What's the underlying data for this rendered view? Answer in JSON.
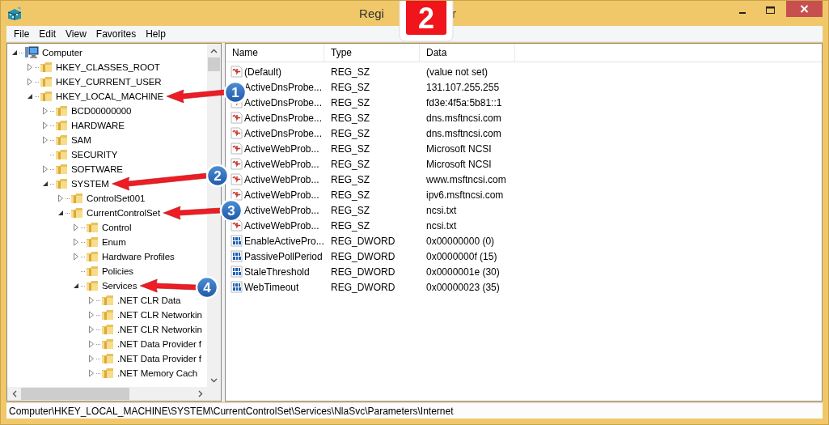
{
  "window": {
    "title_start": "Regi",
    "title_end": "r"
  },
  "menu": [
    "File",
    "Edit",
    "View",
    "Favorites",
    "Help"
  ],
  "tree": [
    {
      "label": "Computer",
      "kind": "computer",
      "expanded": true,
      "children": [
        {
          "label": "HKEY_CLASSES_ROOT",
          "kind": "key",
          "expanded": false
        },
        {
          "label": "HKEY_CURRENT_USER",
          "kind": "key",
          "expanded": false
        },
        {
          "label": "HKEY_LOCAL_MACHINE",
          "kind": "key",
          "expanded": true,
          "children": [
            {
              "label": "BCD00000000",
              "kind": "key",
              "expanded": false
            },
            {
              "label": "HARDWARE",
              "kind": "key",
              "expanded": false
            },
            {
              "label": "SAM",
              "kind": "key",
              "expanded": false
            },
            {
              "label": "SECURITY",
              "kind": "leaf_key"
            },
            {
              "label": "SOFTWARE",
              "kind": "key",
              "expanded": false
            },
            {
              "label": "SYSTEM",
              "kind": "key",
              "expanded": true,
              "children": [
                {
                  "label": "ControlSet001",
                  "kind": "key",
                  "expanded": false
                },
                {
                  "label": "CurrentControlSet",
                  "kind": "key",
                  "expanded": true,
                  "children": [
                    {
                      "label": "Control",
                      "kind": "key",
                      "expanded": false
                    },
                    {
                      "label": "Enum",
                      "kind": "key",
                      "expanded": false
                    },
                    {
                      "label": "Hardware Profiles",
                      "kind": "key",
                      "expanded": false
                    },
                    {
                      "label": "Policies",
                      "kind": "leaf_key"
                    },
                    {
                      "label": "Services",
                      "kind": "key",
                      "expanded": true,
                      "children": [
                        {
                          "label": ".NET CLR Data",
                          "kind": "key",
                          "expanded": false
                        },
                        {
                          "label": ".NET CLR Networkin",
                          "kind": "key",
                          "expanded": false
                        },
                        {
                          "label": ".NET CLR Networkin",
                          "kind": "key",
                          "expanded": false
                        },
                        {
                          "label": ".NET Data Provider f",
                          "kind": "key",
                          "expanded": false
                        },
                        {
                          "label": ".NET Data Provider f",
                          "kind": "key",
                          "expanded": false
                        },
                        {
                          "label": ".NET Memory Cach",
                          "kind": "key",
                          "expanded": false
                        }
                      ]
                    }
                  ]
                }
              ]
            }
          ]
        }
      ]
    }
  ],
  "values": {
    "columns": [
      "Name",
      "Type",
      "Data"
    ],
    "rows": [
      {
        "kind": "string",
        "name": "(Default)",
        "type": "REG_SZ",
        "data": "(value not set)"
      },
      {
        "kind": "string",
        "name": "ActiveDnsProbe...",
        "type": "REG_SZ",
        "data": "131.107.255.255"
      },
      {
        "kind": "string",
        "name": "ActiveDnsProbe...",
        "type": "REG_SZ",
        "data": "fd3e:4f5a:5b81::1"
      },
      {
        "kind": "string",
        "name": "ActiveDnsProbe...",
        "type": "REG_SZ",
        "data": "dns.msftncsi.com"
      },
      {
        "kind": "string",
        "name": "ActiveDnsProbe...",
        "type": "REG_SZ",
        "data": "dns.msftncsi.com"
      },
      {
        "kind": "string",
        "name": "ActiveWebProb...",
        "type": "REG_SZ",
        "data": "Microsoft NCSI"
      },
      {
        "kind": "string",
        "name": "ActiveWebProb...",
        "type": "REG_SZ",
        "data": "Microsoft NCSI"
      },
      {
        "kind": "string",
        "name": "ActiveWebProb...",
        "type": "REG_SZ",
        "data": "www.msftncsi.com"
      },
      {
        "kind": "string",
        "name": "ActiveWebProb...",
        "type": "REG_SZ",
        "data": "ipv6.msftncsi.com"
      },
      {
        "kind": "string",
        "name": "ActiveWebProb...",
        "type": "REG_SZ",
        "data": "ncsi.txt"
      },
      {
        "kind": "string",
        "name": "ActiveWebProb...",
        "type": "REG_SZ",
        "data": "ncsi.txt"
      },
      {
        "kind": "dword",
        "name": "EnableActivePro...",
        "type": "REG_DWORD",
        "data": "0x00000000 (0)"
      },
      {
        "kind": "dword",
        "name": "PassivePollPeriod",
        "type": "REG_DWORD",
        "data": "0x0000000f (15)"
      },
      {
        "kind": "dword",
        "name": "StaleThreshold",
        "type": "REG_DWORD",
        "data": "0x0000001e (30)"
      },
      {
        "kind": "dword",
        "name": "WebTimeout",
        "type": "REG_DWORD",
        "data": "0x00000023 (35)"
      }
    ]
  },
  "status_bar": "Computer\\HKEY_LOCAL_MACHINE\\SYSTEM\\CurrentControlSet\\Services\\NlaSvc\\Parameters\\Internet",
  "step_badge": "2",
  "callouts": [
    "1",
    "2",
    "3",
    "4"
  ]
}
